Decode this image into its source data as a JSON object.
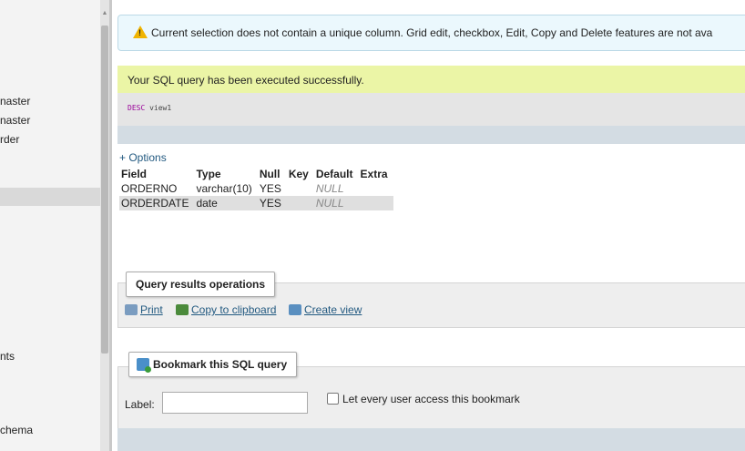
{
  "nav": {
    "items": [
      {
        "label": "naster"
      },
      {
        "label": "naster"
      },
      {
        "label": "rder"
      },
      {
        "label": "nts"
      },
      {
        "label": "chema"
      }
    ]
  },
  "notice": {
    "icon": "warning-icon",
    "text": "Current selection does not contain a unique column. Grid edit, checkbox, Edit, Copy and Delete features are not ava"
  },
  "success": {
    "text": "Your SQL query has been executed successfully."
  },
  "sql": {
    "keyword": "DESC",
    "rest": " view1"
  },
  "options_link": "+ Options",
  "table": {
    "headers": [
      "Field",
      "Type",
      "Null",
      "Key",
      "Default",
      "Extra"
    ],
    "rows": [
      [
        "ORDERNO",
        "varchar(10)",
        "YES",
        "",
        "NULL",
        ""
      ],
      [
        "ORDERDATE",
        "date",
        "YES",
        "",
        "NULL",
        ""
      ]
    ]
  },
  "query_ops": {
    "legend": "Query results operations",
    "print": "Print",
    "copy": "Copy to clipboard",
    "create_view": "Create view"
  },
  "bookmark": {
    "legend": "Bookmark this SQL query",
    "label": "Label:",
    "input_value": "",
    "checkbox_label": "Let every user access this bookmark"
  },
  "colors": {
    "notice_bg": "#ebf8fd",
    "success_bg": "#ebf5a6",
    "link": "#235a81"
  }
}
